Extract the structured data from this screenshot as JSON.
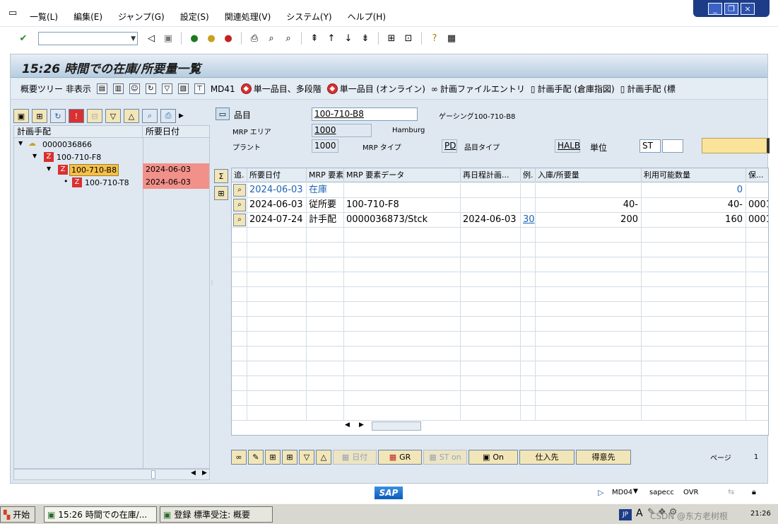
{
  "menu": {
    "items": [
      "一覧(L)",
      "編集(E)",
      "ジャンプ(G)",
      "設定(S)",
      "関連処理(V)",
      "システム(Y)",
      "ヘルプ(H)"
    ]
  },
  "window": {
    "controls": [
      "_",
      "❐",
      "×"
    ]
  },
  "screen": {
    "title": "15:26 時間での在庫/所要量一覧"
  },
  "app_toolbar": {
    "overview_tree": "概要ツリー 非表示",
    "md41": "MD41",
    "single_multi": "単一品目、多段階",
    "single_online": "単一品目 (オンライン)",
    "plan_file": "計画ファイルエントリ",
    "mrp_controller_wh": "計画手配 (倉庫指図)",
    "mrp_controller_more": "計画手配 (標"
  },
  "tree": {
    "col_node": "計画手配",
    "col_date": "所要日付",
    "rows": [
      {
        "label": "0000036866",
        "date": ""
      },
      {
        "label": "100-710-F8",
        "date": ""
      },
      {
        "label": "100-710-B8",
        "date": "2024-06-03"
      },
      {
        "label": "100-710-T8",
        "date": "2024-06-03"
      }
    ]
  },
  "header": {
    "material_label": "品目",
    "material_value": "100-710-B8",
    "material_desc": "ゲーシング100-710-B8",
    "mrp_area_label": "MRP エリア",
    "mrp_area_value": "1000",
    "mrp_area_desc": "Hamburg",
    "plant_label": "プラント",
    "plant_value": "1000",
    "mrp_type_label": "MRP タイプ",
    "mrp_type_value": "PD",
    "material_type_label": "品目タイプ",
    "material_type_value": "HALB",
    "unit_label": "単位",
    "unit_value": "ST"
  },
  "grid": {
    "headers": [
      "追.",
      "所要日付",
      "MRP 要素",
      "MRP 要素データ",
      "再日程計画...",
      "例.",
      "入庫/所要量",
      "利用可能数量",
      "保..."
    ],
    "rows": [
      {
        "date": "2024-06-03",
        "elem": "在庫",
        "data": "",
        "resched": "",
        "exc": "",
        "qty": "",
        "avail": "0",
        "store": ""
      },
      {
        "date": "2024-06-03",
        "elem": "従所要",
        "data": "100-710-F8",
        "resched": "",
        "exc": "",
        "qty": "40-",
        "avail": "40-",
        "store": "0001"
      },
      {
        "date": "2024-07-24",
        "elem": "計手配",
        "data": "0000036873/Stck",
        "resched": "2024-06-03",
        "exc": "30",
        "qty": "200",
        "avail": "160",
        "store": "0001"
      }
    ]
  },
  "bottom_buttons": {
    "date": "日付",
    "gr": "GR",
    "st_on": "ST on",
    "on": "On",
    "vendor": "仕入先",
    "customer": "得意先",
    "page_label": "ページ",
    "page_value": "1"
  },
  "status": {
    "sap": "SAP",
    "tcode": "MD04",
    "server": "sapecc",
    "mode": "OVR"
  },
  "taskbar": {
    "start": "开始",
    "task1": "15:26 時間での在庫/...",
    "task2": "登録 標準受注: 概要",
    "lang": "JP",
    "clock": "21:26",
    "watermark": "CSDN @东方老树根"
  },
  "colors": {
    "frame_bg": "#dfe8f1",
    "highlight": "#f2908a",
    "selected_node": "#f5c04a",
    "link_blue": "#1d64b5"
  }
}
